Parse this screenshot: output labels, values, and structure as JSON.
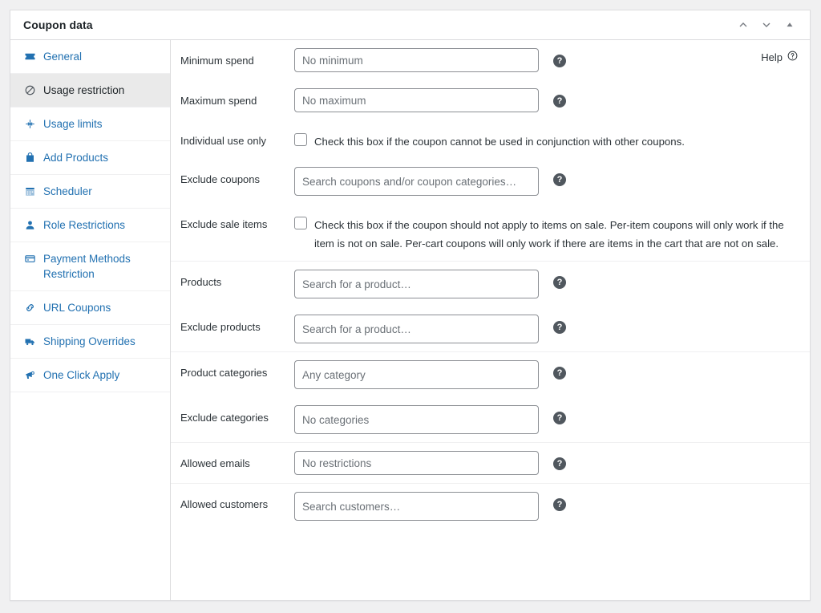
{
  "panel": {
    "title": "Coupon data",
    "actions": [
      {
        "name": "move-up",
        "glyph": "chevron-up"
      },
      {
        "name": "move-down",
        "glyph": "chevron-down"
      },
      {
        "name": "toggle-panel",
        "glyph": "triangle-up"
      }
    ]
  },
  "help": {
    "label": "Help",
    "icon": "question-circle-outline-icon"
  },
  "sidebar": {
    "items": [
      {
        "label": "General",
        "icon": "ticket-icon",
        "active": false
      },
      {
        "label": "Usage restriction",
        "icon": "block-icon",
        "active": true
      },
      {
        "label": "Usage limits",
        "icon": "limits-icon",
        "active": false
      },
      {
        "label": "Add Products",
        "icon": "shopping-bag-icon",
        "active": false
      },
      {
        "label": "Scheduler",
        "icon": "calendar-icon",
        "active": false
      },
      {
        "label": "Role Restrictions",
        "icon": "user-icon",
        "active": false
      },
      {
        "label": "Payment Methods Restriction",
        "icon": "credit-card-icon",
        "active": false
      },
      {
        "label": "URL Coupons",
        "icon": "link-icon",
        "active": false
      },
      {
        "label": "Shipping Overrides",
        "icon": "truck-icon",
        "active": false
      },
      {
        "label": "One Click Apply",
        "icon": "megaphone-icon",
        "active": false
      }
    ]
  },
  "form": {
    "minimum_spend": {
      "label": "Minimum spend",
      "placeholder": "No minimum",
      "value": ""
    },
    "maximum_spend": {
      "label": "Maximum spend",
      "placeholder": "No maximum",
      "value": ""
    },
    "individual_use": {
      "label": "Individual use only",
      "checked": false,
      "description": "Check this box if the coupon cannot be used in conjunction with other coupons."
    },
    "exclude_coupons": {
      "label": "Exclude coupons",
      "placeholder": "Search coupons and/or coupon categories…",
      "value": ""
    },
    "exclude_sale_items": {
      "label": "Exclude sale items",
      "checked": false,
      "description": "Check this box if the coupon should not apply to items on sale. Per-item coupons will only work if the item is not on sale. Per-cart coupons will only work if there are items in the cart that are not on sale."
    },
    "products": {
      "label": "Products",
      "placeholder": "Search for a product…",
      "value": ""
    },
    "exclude_products": {
      "label": "Exclude products",
      "placeholder": "Search for a product…",
      "value": ""
    },
    "product_categories": {
      "label": "Product categories",
      "placeholder": "Any category",
      "value": ""
    },
    "exclude_categories": {
      "label": "Exclude categories",
      "placeholder": "No categories",
      "value": ""
    },
    "allowed_emails": {
      "label": "Allowed emails",
      "placeholder": "No restrictions",
      "value": ""
    },
    "allowed_customers": {
      "label": "Allowed customers",
      "placeholder": "Search customers…",
      "value": ""
    }
  },
  "tooltip_glyph": "?",
  "colors": {
    "link": "#2271b1",
    "text": "#2c3338",
    "panel_border": "#dcdcde",
    "active_row": "#eaeaea",
    "input_border": "#8c8f94",
    "tooltip_bg": "#50575e",
    "page_bg": "#f0f0f1"
  }
}
